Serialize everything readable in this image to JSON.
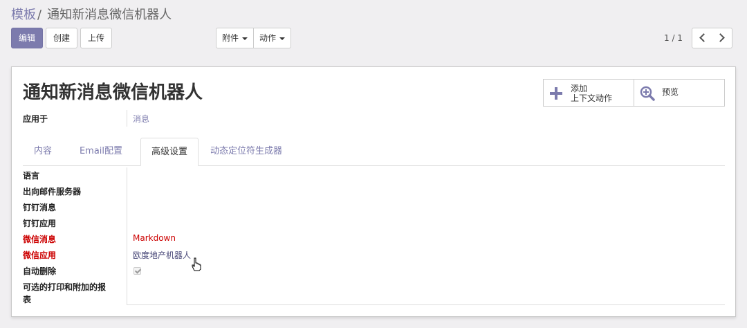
{
  "breadcrumb": {
    "parent": "模板",
    "separator": "/",
    "current": "通知新消息微信机器人"
  },
  "toolbar": {
    "edit_label": "编辑",
    "create_label": "创建",
    "upload_label": "上传",
    "attachment_label": "附件",
    "action_label": "动作"
  },
  "pager": {
    "value": "1 / 1"
  },
  "record": {
    "title": "通知新消息微信机器人",
    "apply_to_label": "应用于",
    "apply_to_value": "消息"
  },
  "smart_buttons": {
    "add_context_action_line1": "添加",
    "add_context_action_line2": "上下文动作",
    "preview_label": "预览"
  },
  "tabs": [
    "内容",
    "Email配置",
    "高级设置",
    "动态定位符生成器"
  ],
  "active_tab": "高级设置",
  "advanced": {
    "fields": [
      {
        "label": "语言",
        "value": "",
        "required": false
      },
      {
        "label": "出向邮件服务器",
        "value": "",
        "required": false
      },
      {
        "label": "钉钉消息",
        "value": "",
        "required": false
      },
      {
        "label": "钉钉应用",
        "value": "",
        "required": false
      },
      {
        "label": "微信消息",
        "value": "Markdown",
        "required": true
      },
      {
        "label": "微信应用",
        "value": "欧度地产机器人",
        "required": true
      },
      {
        "label": "自动删除",
        "value": "",
        "required": false
      },
      {
        "label": "可选的打印和附加的报表",
        "value": "",
        "required": false
      }
    ],
    "report_label_line1": "可选的打印和附加的报",
    "report_label_line2": "表",
    "auto_delete_checked": true
  },
  "colors": {
    "brand": "#7c7bad",
    "required": "#cc0000",
    "background": "#f0eff1"
  },
  "icons": [
    "plus-icon",
    "magnifier-plus-icon",
    "caret-down-icon",
    "chevron-left-icon",
    "chevron-right-icon",
    "hand-cursor-icon"
  ]
}
